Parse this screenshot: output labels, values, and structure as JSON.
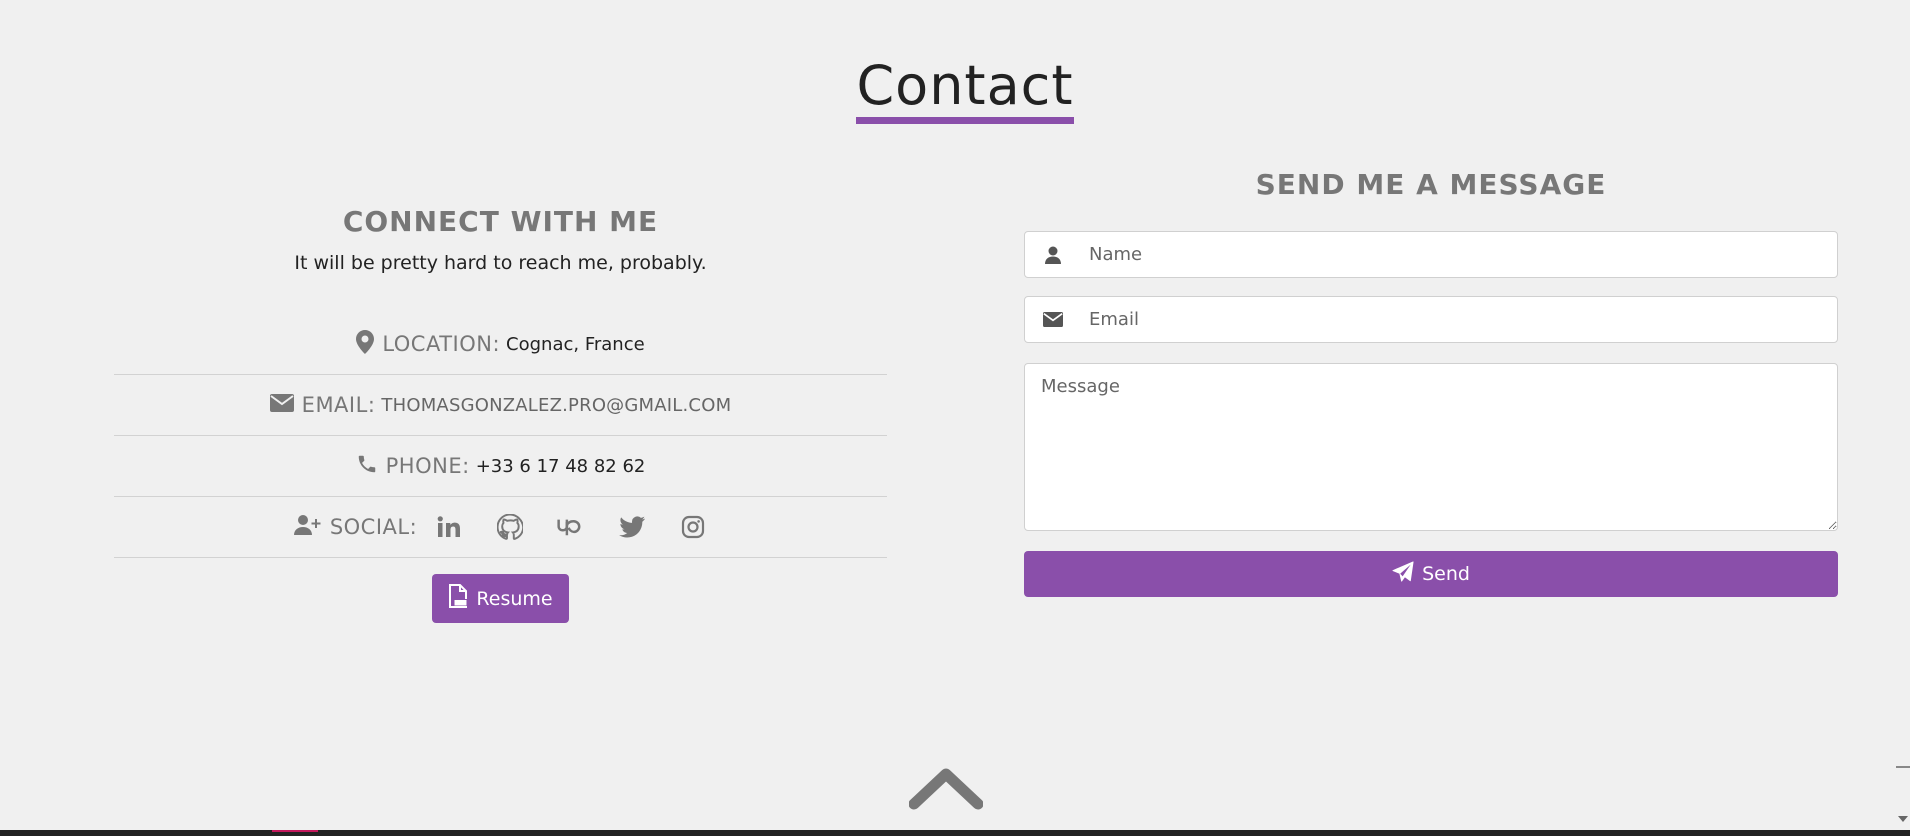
{
  "section": {
    "title": "Contact"
  },
  "connect": {
    "heading": "CONNECT WITH ME",
    "subtitle": "It will be pretty hard to reach me, probably.",
    "location_label": "LOCATION:",
    "location_value": "Cognac, France",
    "email_label": "EMAIL:",
    "email_value": "THOMASGONZALEZ.PRO@GMAIL.COM",
    "phone_label": "PHONE:",
    "phone_value": "+33 6 17 48 82 62",
    "social_label": "SOCIAL:",
    "social_icons": [
      "linkedin-icon",
      "github-icon",
      "upwork-icon",
      "twitter-icon",
      "instagram-icon"
    ],
    "resume_label": "Resume"
  },
  "form": {
    "heading": "SEND ME A MESSAGE",
    "name_placeholder": "Name",
    "email_placeholder": "Email",
    "message_placeholder": "Message",
    "send_label": "Send"
  },
  "colors": {
    "accent": "#8a4faa",
    "background": "#f0f0f0",
    "muted_text": "#777777"
  }
}
